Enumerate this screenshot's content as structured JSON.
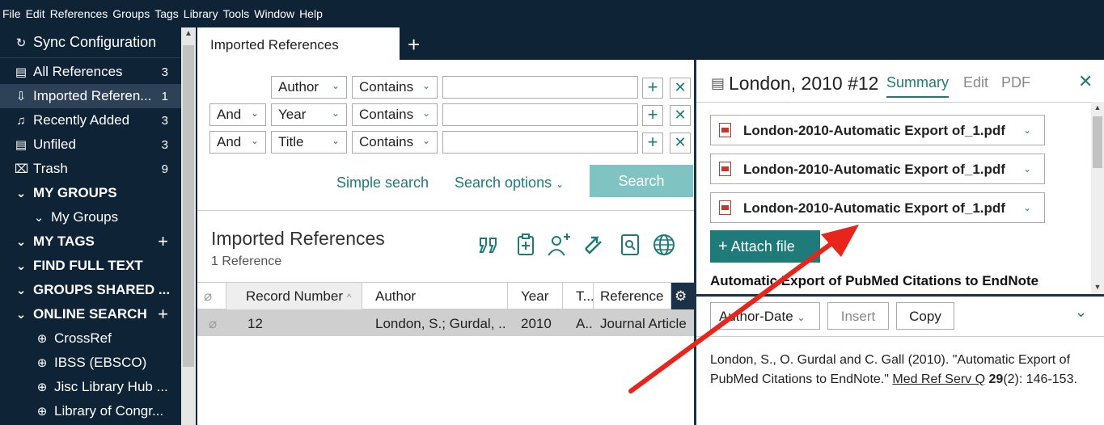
{
  "menu": [
    "File",
    "Edit",
    "References",
    "Groups",
    "Tags",
    "Library",
    "Tools",
    "Window",
    "Help"
  ],
  "sidebar": {
    "sync": "Sync Configuration",
    "items": [
      {
        "label": "All References",
        "count": "3"
      },
      {
        "label": "Imported Referen...",
        "count": "1"
      },
      {
        "label": "Recently Added",
        "count": "3"
      },
      {
        "label": "Unfiled",
        "count": "3"
      },
      {
        "label": "Trash",
        "count": "9"
      }
    ],
    "my_groups": "MY GROUPS",
    "my_groups_sub": "My Groups",
    "my_tags": "MY TAGS",
    "find_full_text": "FIND FULL TEXT",
    "groups_shared": "GROUPS SHARED ...",
    "online_search": "ONLINE SEARCH",
    "online_items": [
      "CrossRef",
      "IBSS (EBSCO)",
      "Jisc Library Hub ...",
      "Library of Congr..."
    ]
  },
  "tab": {
    "label": "Imported References"
  },
  "search": {
    "rows": [
      {
        "bool": "",
        "field": "Author",
        "op": "Contains"
      },
      {
        "bool": "And",
        "field": "Year",
        "op": "Contains"
      },
      {
        "bool": "And",
        "field": "Title",
        "op": "Contains"
      }
    ],
    "simple": "Simple search",
    "options": "Search options",
    "button": "Search"
  },
  "library": {
    "title": "Imported References",
    "count": "1 Reference",
    "columns": [
      "Record Number",
      "Author",
      "Year",
      "T...",
      "Reference"
    ],
    "rows": [
      {
        "record": "12",
        "author": "London, S.; Gurdal, ...",
        "year": "2010",
        "type": "A..",
        "reftype": "Journal Article"
      }
    ]
  },
  "detail": {
    "title": "London, 2010 #12",
    "tabs": [
      "Summary",
      "Edit",
      "PDF"
    ],
    "pdfs": [
      "London-2010-Automatic Export of_1.pdf",
      "London-2010-Automatic Export of_1.pdf",
      "London-2010-Automatic Export of_1.pdf"
    ],
    "attach": "Attach file",
    "ref_title": "Automatic Export of PubMed Citations to EndNote",
    "style": "Author-Date",
    "insert": "Insert",
    "copy": "Copy",
    "citation_a": "London, S., O. Gurdal and C. Gall (2010). \"Automatic Export of PubMed Citations to EndNote.\" ",
    "citation_journal": "Med Ref Serv Q",
    "citation_vol": "29",
    "citation_b": "(2): 146-153."
  },
  "colors": {
    "dark": "#0f2337",
    "accent": "#1f7a7a",
    "search_btn": "#7fc3c3",
    "arrow": "#e8251b"
  }
}
